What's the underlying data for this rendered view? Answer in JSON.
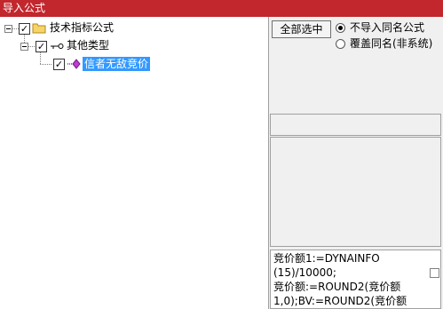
{
  "window": {
    "title": "导入公式"
  },
  "tree": {
    "root": {
      "label": "技术指标公式",
      "checked": "✓"
    },
    "child": {
      "label": "其他类型",
      "checked": "✓"
    },
    "leaf": {
      "label": "信者无敌竞价",
      "checked": "✓"
    }
  },
  "options": {
    "select_all_label": "全部选中",
    "radio_skip_label": "不导入同名公式",
    "radio_overwrite_label": "覆盖同名(非系统)"
  },
  "formula_preview": {
    "lines": [
      "竞价额1:=DYNAINFO",
      "(15)/10000;",
      "竞价额:=ROUND2(竞价额",
      "1,0);BV:=ROUND2(竞价额"
    ]
  },
  "colors": {
    "titlebar": "#c1272d",
    "selection": "#3399ff"
  }
}
